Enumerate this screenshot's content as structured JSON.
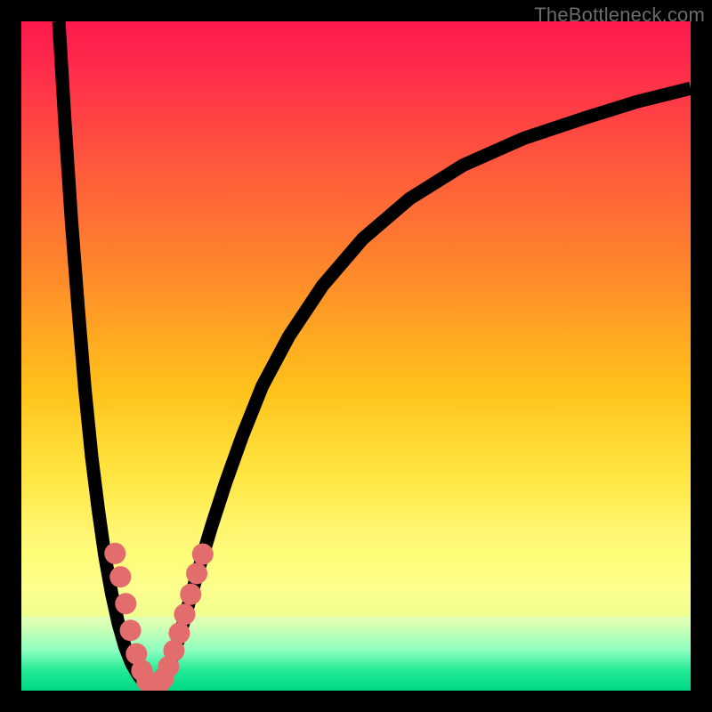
{
  "watermark": {
    "text": "TheBottleneck.com"
  },
  "colors": {
    "frame": "#000000",
    "curve": "#000000",
    "dot": "#e36d6d"
  },
  "chart_data": {
    "type": "line",
    "title": "",
    "xlabel": "",
    "ylabel": "",
    "xlim": [
      0,
      100
    ],
    "ylim": [
      0,
      100
    ],
    "series": [
      {
        "name": "curve",
        "x": [
          5.6,
          6.5,
          7.5,
          8.5,
          9.5,
          10.5,
          11.5,
          12.5,
          13.5,
          14.5,
          15.5,
          16.5,
          17.5,
          18.5,
          19.3,
          20.1,
          21.0,
          22.2,
          23.6,
          25.0,
          26.6,
          28.4,
          30.5,
          33.0,
          36.0,
          40.0,
          45.0,
          51.0,
          58.0,
          66.0,
          75.0,
          84.0,
          92.0,
          100.0
        ],
        "y": [
          100.0,
          85.0,
          70.0,
          57.0,
          45.0,
          35.0,
          27.0,
          20.0,
          14.5,
          10.0,
          6.5,
          4.0,
          2.3,
          1.0,
          0.3,
          0.4,
          1.5,
          4.0,
          8.0,
          13.0,
          18.5,
          24.5,
          31.0,
          38.0,
          45.5,
          53.0,
          60.5,
          67.5,
          73.5,
          78.5,
          82.5,
          85.5,
          88.0,
          90.0
        ]
      }
    ],
    "annotations": {
      "dots": [
        {
          "x": 14.0,
          "y": 20.5,
          "r": 1.6
        },
        {
          "x": 14.8,
          "y": 17.0,
          "r": 1.6
        },
        {
          "x": 15.6,
          "y": 13.0,
          "r": 1.6
        },
        {
          "x": 16.3,
          "y": 9.0,
          "r": 1.6
        },
        {
          "x": 17.2,
          "y": 5.5,
          "r": 1.6
        },
        {
          "x": 18.0,
          "y": 3.0,
          "r": 1.6
        },
        {
          "x": 18.8,
          "y": 1.4,
          "r": 1.6
        },
        {
          "x": 19.6,
          "y": 0.5,
          "r": 1.6
        },
        {
          "x": 20.4,
          "y": 0.7,
          "r": 1.6
        },
        {
          "x": 21.2,
          "y": 1.8,
          "r": 1.6
        },
        {
          "x": 22.0,
          "y": 3.6,
          "r": 1.6
        },
        {
          "x": 22.8,
          "y": 6.0,
          "r": 1.6
        },
        {
          "x": 23.6,
          "y": 8.6,
          "r": 1.6
        },
        {
          "x": 24.4,
          "y": 11.4,
          "r": 1.6
        },
        {
          "x": 25.3,
          "y": 14.4,
          "r": 1.6
        },
        {
          "x": 26.2,
          "y": 17.5,
          "r": 1.6
        },
        {
          "x": 27.1,
          "y": 20.4,
          "r": 1.6
        }
      ]
    }
  }
}
